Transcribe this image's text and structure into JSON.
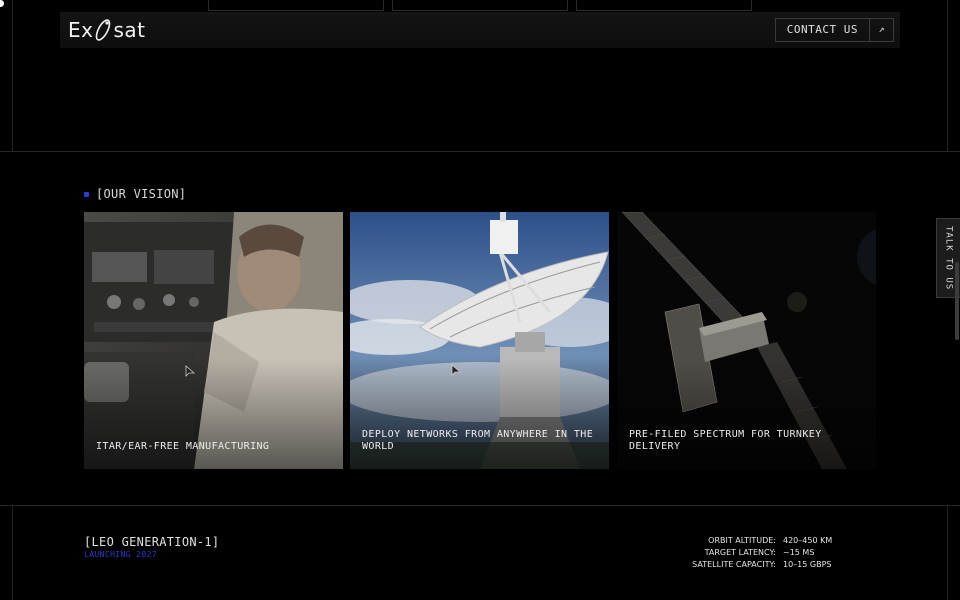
{
  "header": {
    "logo_left": "Ex",
    "logo_right": "sat",
    "contact_label": "CONTACT US",
    "contact_arrow": "↗"
  },
  "vision": {
    "label": "[OUR VISION]",
    "accent": "#2b3ae8",
    "cards": [
      {
        "caption": "ITAR/EAR-FREE MANUFACTURING",
        "image": "engineer-with-radio-equipment"
      },
      {
        "caption": "DEPLOY NETWORKS FROM ANYWHERE IN THE WORLD",
        "image": "radio-telescope-dish"
      },
      {
        "caption": "PRE-FILED SPECTRUM FOR TURNKEY DELIVERY",
        "image": "satellite-in-orbit"
      }
    ]
  },
  "side_tab": {
    "label": "TALK TO US"
  },
  "generation": {
    "title": "[LEO GENERATION-1]",
    "subtitle": "LAUNCHING 2027",
    "subtitle_color": "#2b35d8",
    "specs": [
      {
        "key": "ORBIT ALTITUDE:",
        "value": "420–450 KM"
      },
      {
        "key": "TARGET LATENCY:",
        "value": "~15 MS"
      },
      {
        "key": "SATELLITE CAPACITY:",
        "value": "10–15 GBPS"
      }
    ]
  }
}
